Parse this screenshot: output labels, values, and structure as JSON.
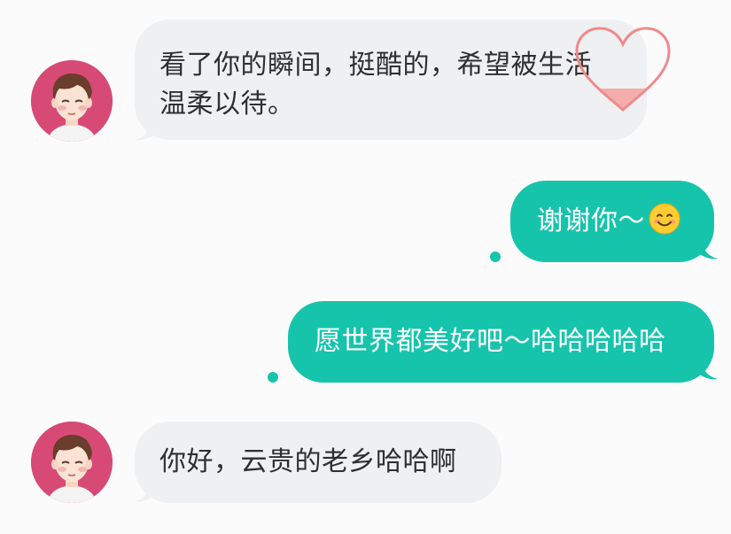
{
  "messages": [
    {
      "direction": "incoming",
      "sender_avatar": "cartoon-boy-avatar",
      "text": "看了你的瞬间，挺酷的，希望被生活温柔以待。",
      "line1": "看了你的瞬间，挺酷的，希望被生活",
      "line2": "温柔以待。",
      "decoration": "heart-outline-icon"
    },
    {
      "direction": "outgoing",
      "text": "谢谢你～",
      "emoji": "smiling-face-emoji"
    },
    {
      "direction": "outgoing",
      "text": "愿世界都美好吧～哈哈哈哈哈"
    },
    {
      "direction": "incoming",
      "sender_avatar": "cartoon-boy-avatar",
      "text": "你好，云贵的老乡哈哈啊"
    }
  ],
  "colors": {
    "background": "#fbfbfc",
    "incoming_bubble": "#eef0f2",
    "incoming_text": "#2f2f2f",
    "outgoing_bubble": "#16c4ac",
    "outgoing_text": "#ffffff",
    "avatar_bg": "#d74a76",
    "heart": "#f08a8a"
  }
}
